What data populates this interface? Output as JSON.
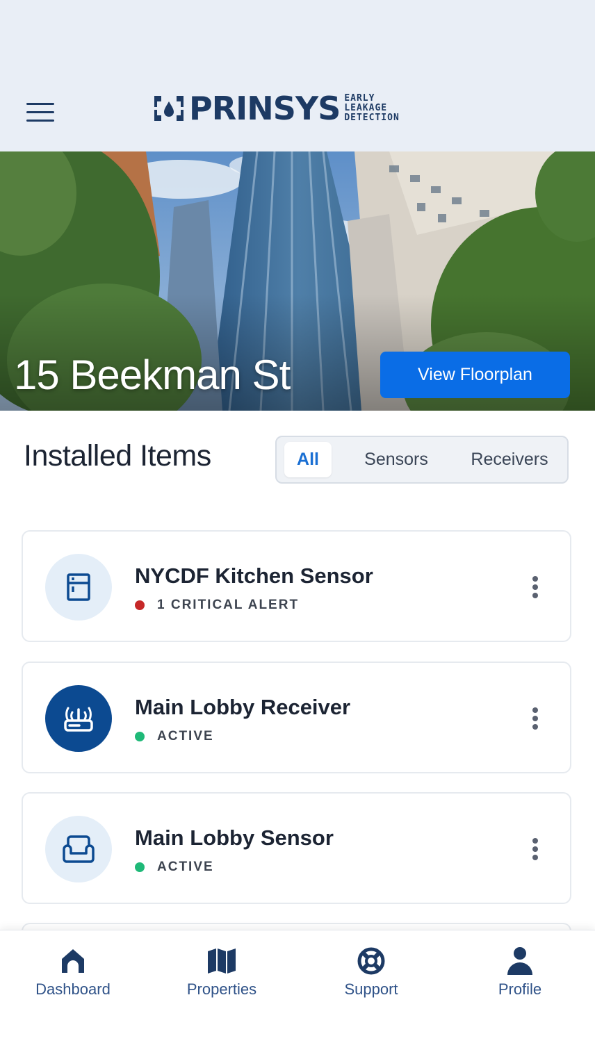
{
  "header": {
    "brand": "PRINSYS",
    "tagline": [
      "EARLY",
      "LEAKAGE",
      "DETECTION"
    ]
  },
  "property": {
    "name": "15 Beekman St",
    "floorplan_button": "View Floorplan"
  },
  "installed": {
    "title": "Installed Items",
    "filters": [
      "All",
      "Sensors",
      "Receivers"
    ],
    "active_filter": "All",
    "items": [
      {
        "name": "NYCDF Kitchen Sensor",
        "status": "1 CRITICAL ALERT",
        "status_color": "#c62828",
        "icon": "fridge-icon"
      },
      {
        "name": "Main Lobby Receiver",
        "status": "ACTIVE",
        "status_color": "#1fb978",
        "icon": "router-icon"
      },
      {
        "name": "Main Lobby Sensor",
        "status": "ACTIVE",
        "status_color": "#1fb978",
        "icon": "couch-icon"
      }
    ]
  },
  "tabbar": {
    "tabs": [
      {
        "label": "Dashboard",
        "icon": "home-icon"
      },
      {
        "label": "Properties",
        "icon": "map-icon"
      },
      {
        "label": "Support",
        "icon": "lifebuoy-icon"
      },
      {
        "label": "Profile",
        "icon": "user-icon"
      }
    ]
  },
  "colors": {
    "brand_navy": "#1d3a64",
    "accent_blue": "#0a6de6",
    "critical": "#c62828",
    "active": "#1fb978"
  }
}
